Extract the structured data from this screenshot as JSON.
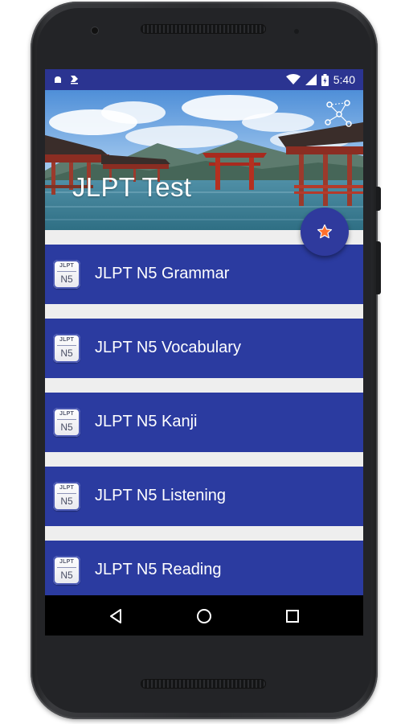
{
  "status_bar": {
    "time": "5:40",
    "left_icons": [
      "notification-icon",
      "download-icon"
    ],
    "right_icons": [
      "wifi-icon",
      "signal-icon",
      "battery-icon"
    ]
  },
  "app": {
    "title": "JLPT Test"
  },
  "header": {
    "share_icon": "share-icon",
    "fab_icon": "star-icon",
    "fab_star_color": "#ff6f2c"
  },
  "menu": {
    "badge_top": "JLPT",
    "badge_bottom": "N5",
    "items": [
      {
        "label": "JLPT N5 Grammar"
      },
      {
        "label": "JLPT N5 Vocabulary"
      },
      {
        "label": "JLPT N5 Kanji"
      },
      {
        "label": "JLPT N5 Listening"
      },
      {
        "label": "JLPT N5 Reading"
      }
    ]
  },
  "nav_bar": {
    "buttons": [
      "back-icon",
      "home-icon",
      "recents-icon"
    ]
  },
  "colors": {
    "primary": "#2b3ba0",
    "status_bar": "#2b3491",
    "background": "#eeeeee"
  }
}
